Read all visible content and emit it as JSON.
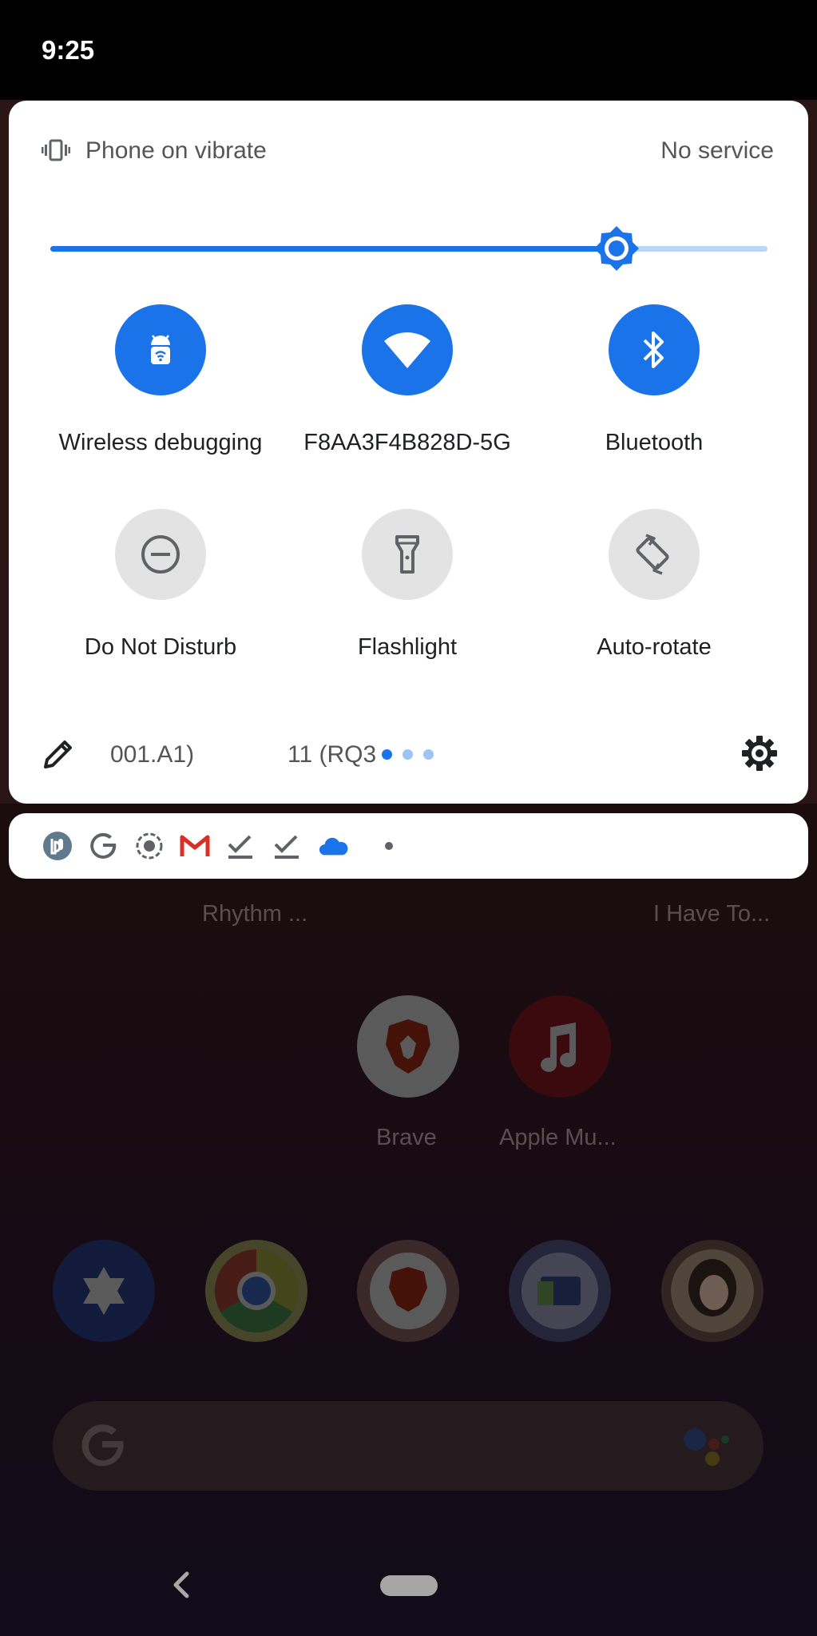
{
  "status_bar": {
    "time": "9:25"
  },
  "quick_settings": {
    "ringer_status": "Phone on vibrate",
    "network_status": "No service",
    "brightness": {
      "level": 0.79
    },
    "tiles": [
      {
        "label": "Wireless debugging",
        "state": "on",
        "icon": "android-debug-icon"
      },
      {
        "label": "F8AA3F4B828D-5G",
        "state": "on",
        "icon": "wifi-icon"
      },
      {
        "label": "Bluetooth",
        "state": "on",
        "icon": "bluetooth-icon"
      },
      {
        "label": "Do Not Disturb",
        "state": "off",
        "icon": "do-not-disturb-icon"
      },
      {
        "label": "Flashlight",
        "state": "off",
        "icon": "flashlight-icon"
      },
      {
        "label": "Auto-rotate",
        "state": "off",
        "icon": "auto-rotate-icon"
      }
    ],
    "footer": {
      "build_text_1": "001.A1)",
      "build_text_2": "11 (RQ3",
      "page_count": 3,
      "active_page": 1
    }
  },
  "notification_icons": [
    "pocket-casts-icon",
    "google-icon",
    "screen-record-icon",
    "gmail-icon",
    "task-done-icon",
    "task-done-icon",
    "cloud-icon",
    "more-dot-icon"
  ],
  "home_screen": {
    "widget_labels": [
      "Rhythm ...",
      "I Have To..."
    ],
    "apps": [
      {
        "label": "Brave",
        "icon": "brave-icon"
      },
      {
        "label": "Apple Mu...",
        "icon": "apple-music-icon"
      }
    ],
    "dock": [
      "star-of-david-app-icon",
      "chrome-icon",
      "brave-icon",
      "files-icon",
      "contact-photo-icon"
    ]
  },
  "colors": {
    "accent": "#1a73e8",
    "accent_light": "#bcd5f7",
    "tile_off": "#e3e3e3",
    "panel": "#ffffff"
  }
}
